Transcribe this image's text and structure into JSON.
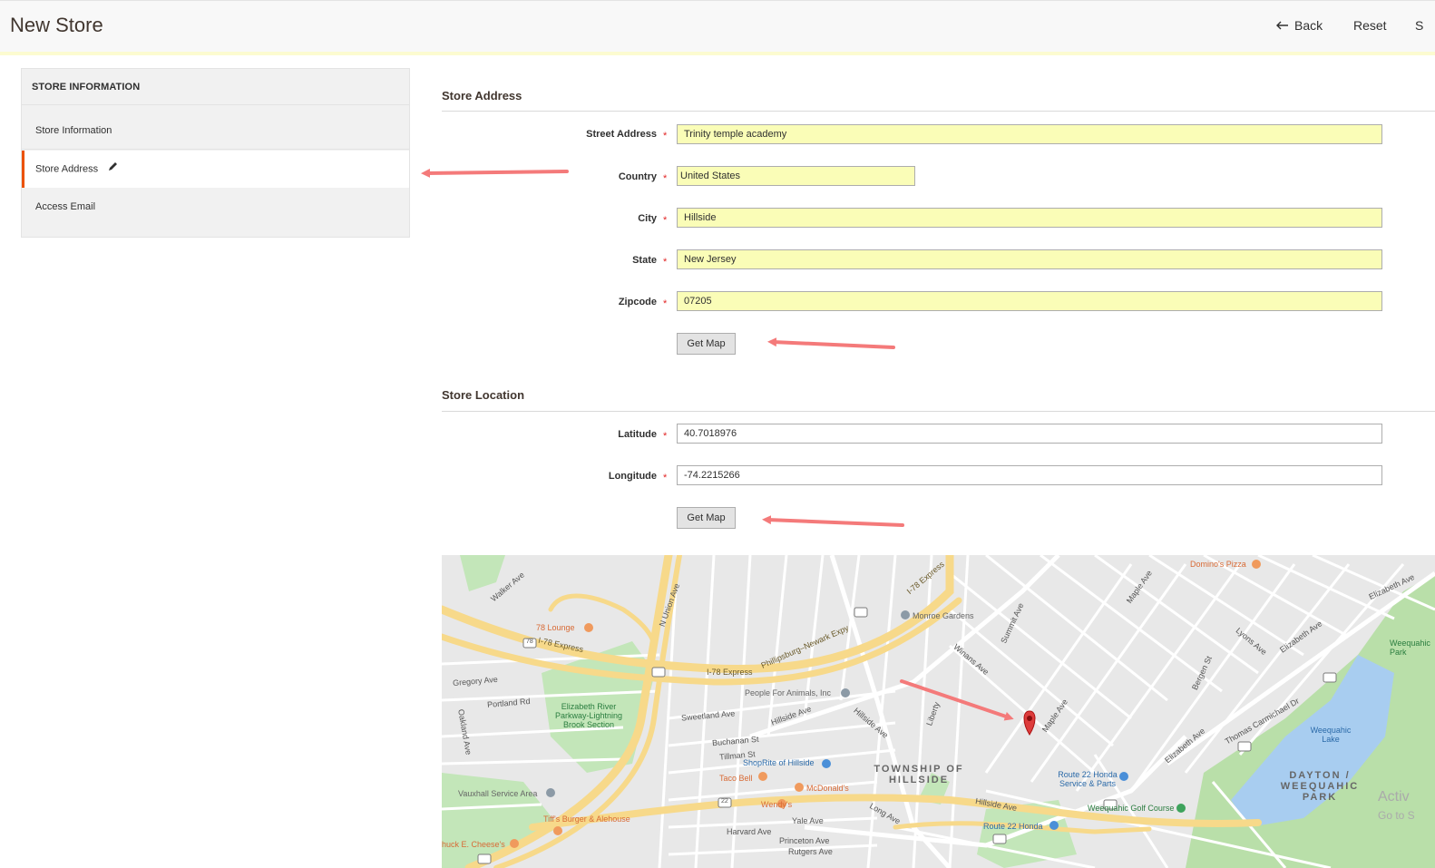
{
  "header": {
    "title": "New Store",
    "back_label": "Back",
    "reset_label": "Reset",
    "save_label": "S"
  },
  "sidebar": {
    "heading": "STORE INFORMATION",
    "items": [
      {
        "label": "Store Information"
      },
      {
        "label": "Store Address",
        "active": true
      },
      {
        "label": "Access Email"
      }
    ]
  },
  "store_address": {
    "title": "Store Address",
    "fields": {
      "street": {
        "label": "Street Address",
        "value": "Trinity temple academy"
      },
      "country": {
        "label": "Country",
        "value": "United States"
      },
      "city": {
        "label": "City",
        "value": "Hillside"
      },
      "state": {
        "label": "State",
        "value": "New Jersey"
      },
      "zipcode": {
        "label": "Zipcode",
        "value": "07205"
      }
    },
    "get_map_label": "Get Map"
  },
  "store_location": {
    "title": "Store Location",
    "fields": {
      "latitude": {
        "label": "Latitude",
        "value": "40.7018976"
      },
      "longitude": {
        "label": "Longitude",
        "value": "-74.2215266"
      }
    },
    "get_map_label": "Get Map"
  },
  "required_mark": "*",
  "map": {
    "labels": {
      "lounge": "78 Lounge",
      "i78_express": "I-78 Express",
      "i78_express2": "I-78 Express",
      "phillipsburg": "Phillipsburg–Newark Expy",
      "i78_express_ne": "I-78 Express",
      "monroe": "Monroe Gardens",
      "dominos": "Domino's Pizza",
      "people_animals": "People For Animals, Inc",
      "elizabeth_river": "Elizabeth River Parkway-Lightning Brook Section",
      "shoprite": "ShopRite of Hillside",
      "taco_bell": "Taco Bell",
      "mcdonalds": "McDonald's",
      "wendys": "Wendy's",
      "township": "TOWNSHIP OF HILLSIDE",
      "route22_honda_service": "Route 22 Honda Service & Parts",
      "weequahic_golf": "Weequahic Golf Course",
      "route22_honda": "Route 22 Honda",
      "vauxhall": "Vauxhall Service Area",
      "tiffs": "Tiff's Burger & Alehouse",
      "chuck": "huck E. Cheese's",
      "weequahic_lake": "Weequahic Lake",
      "dayton_park": "DAYTON / WEEQUAHIC PARK",
      "weequahic_park": "Weequahic Park",
      "activate": "Activ",
      "go_to": "Go to S",
      "hillside_ave": "Hillside Ave",
      "hillside_ave2": "Hillside Ave",
      "hillside_ave3": "Hillside Ave",
      "maple_ave": "Maple Ave",
      "maple_ave2": "Maple Ave",
      "elizabeth_ave": "Elizabeth Ave",
      "elizabeth_ave2": "Elizabeth Ave",
      "elizabeth_ave3": "Elizabeth Ave",
      "winans_ave": "Winans Ave",
      "liberty": "Liberty",
      "summit_ave": "Summit Ave",
      "walker_ave": "Walker Ave",
      "oakland_ave": "Oakland Ave",
      "bergen_st": "Bergen St",
      "lyons_ave": "Lyons Ave",
      "n_union": "N Union Ave",
      "sweetland": "Sweetland Ave",
      "gregory": "Gregory Ave",
      "portland": "Portland Rd",
      "buchanan": "Buchanan St",
      "tillman": "Tillman St",
      "long_ave": "Long Ave",
      "yale_ave": "Yale Ave",
      "harvard": "Harvard Ave",
      "princeton": "Princeton Ave",
      "rutgers": "Rutgers Ave",
      "thomas_carmichael": "Thomas Carmichael Dr",
      "shield_78": "78",
      "shield_22": "22"
    }
  }
}
